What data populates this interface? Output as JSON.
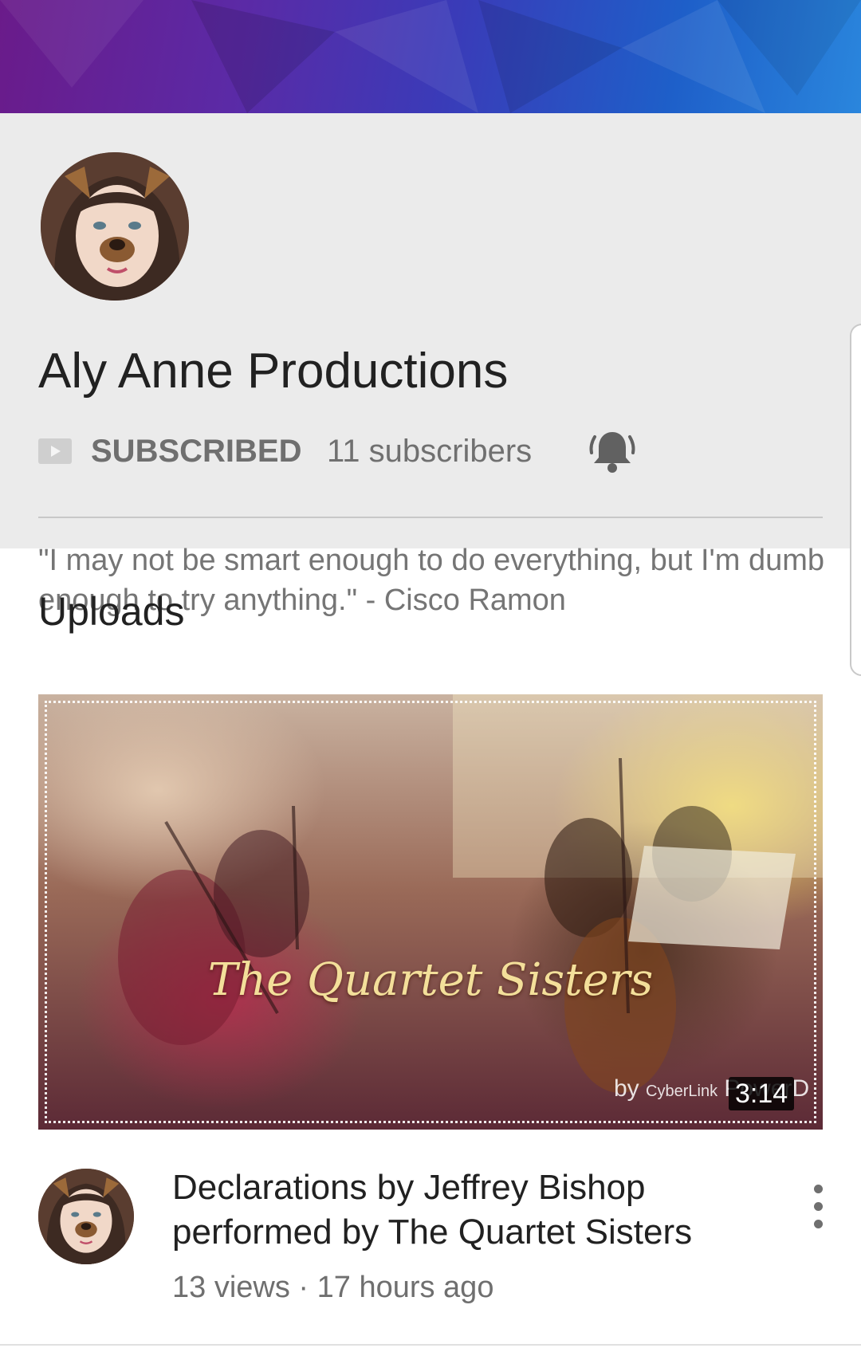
{
  "channel": {
    "name": "Aly Anne Productions",
    "subscribe_status": "SUBSCRIBED",
    "subscribers": "11 subscribers",
    "description": "\"I may not be smart enough to do everything, but I'm dumb enough to try anything.\" - Cisco Ramon"
  },
  "icons": {
    "subscribe_badge": "youtube-play-icon",
    "notifications": "bell-ringing-icon",
    "more": "more-vertical-icon"
  },
  "uploads": {
    "section_title": "Uploads",
    "videos": [
      {
        "thumbnail_title": "The Quartet Sisters",
        "watermark_prefix": "by",
        "watermark_brand_small": "CyberLink",
        "watermark_brand": "PowerD",
        "duration": "3:14",
        "title": "Declarations by Jeffrey Bishop performed by The Quartet Sisters",
        "meta": "13 views · 17 hours ago"
      }
    ]
  },
  "colors": {
    "header_background": "#ebebeb",
    "banner_start": "#6a1b8a",
    "banner_end": "#2a86dd",
    "secondary_text": "#707070"
  }
}
